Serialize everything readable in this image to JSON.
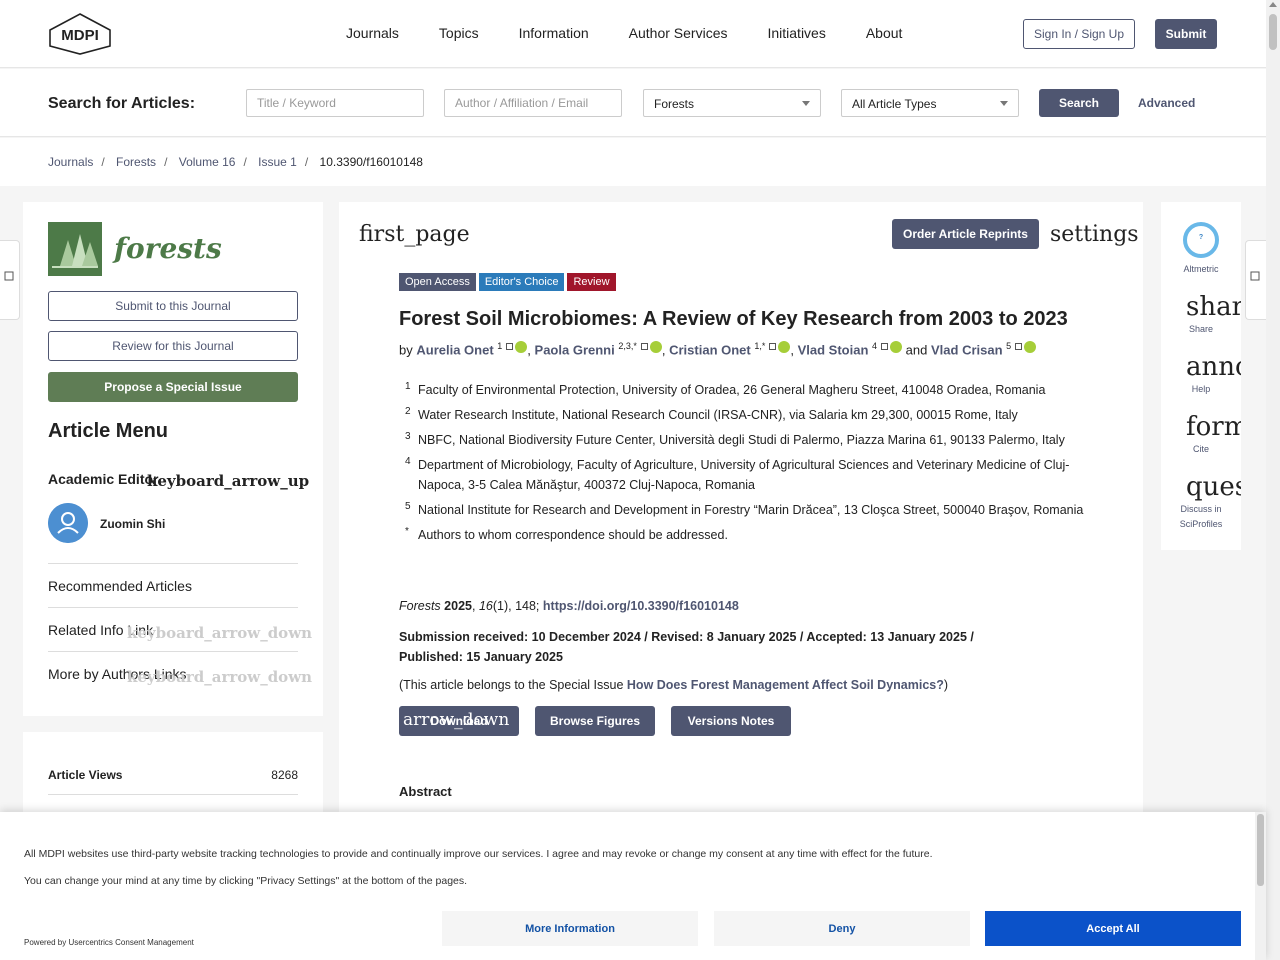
{
  "header": {
    "logo_text": "MDPI",
    "nav": [
      "Journals",
      "Topics",
      "Information",
      "Author Services",
      "Initiatives",
      "About"
    ],
    "sign_in": "Sign In / Sign Up",
    "submit": "Submit"
  },
  "search": {
    "label": "Search for Articles:",
    "title_placeholder": "Title / Keyword",
    "author_placeholder": "Author / Affiliation / Email",
    "journal_value": "Forests",
    "type_value": "All Article Types",
    "search_button": "Search",
    "advanced": "Advanced"
  },
  "breadcrumb": [
    "Journals",
    "Forests",
    "Volume 16",
    "Issue 1",
    "10.3390/f16010148"
  ],
  "sidebar": {
    "journal_name": "forests",
    "submit_btn": "Submit to this Journal",
    "review_btn": "Review for this Journal",
    "propose_btn": "Propose a Special Issue",
    "menu_title": "Article Menu",
    "academic_editor": "Academic Editor",
    "icon_up": "keyboard_arrow_up",
    "icon_down": "keyboard_arrow_down",
    "editor_name": "Zuomin Shi",
    "items": [
      "Recommended Articles",
      "Related Info Link",
      "More by Authors Links"
    ],
    "views_label": "Article Views",
    "views_value": "8268"
  },
  "article": {
    "first_page": "first_page",
    "reprints": "Order Article Reprints",
    "settings": "settings",
    "badges": [
      {
        "label": "Open Access",
        "color": "#4f5671"
      },
      {
        "label": "Editor's Choice",
        "color": "#2b7bba"
      },
      {
        "label": "Review",
        "color": "#a0162b"
      }
    ],
    "title": "Forest Soil Microbiomes: A Review of Key Research from 2003 to 2023",
    "by": "by",
    "authors": [
      {
        "name": "Aurelia Onet",
        "sup": "1"
      },
      {
        "name": "Paola Grenni",
        "sup": "2,3,*"
      },
      {
        "name": "Cristian Onet",
        "sup": "1,*"
      },
      {
        "name": "Vlad Stoian",
        "sup": "4"
      },
      {
        "name": "Vlad Crisan",
        "sup": "5"
      }
    ],
    "and": "and",
    "affiliations": [
      {
        "n": "1",
        "text": "Faculty of Environmental Protection, University of Oradea, 26 General Magheru Street, 410048 Oradea, Romania"
      },
      {
        "n": "2",
        "text": "Water Research Institute, National Research Council (IRSA-CNR), via Salaria km 29,300, 00015 Rome, Italy"
      },
      {
        "n": "3",
        "text": "NBFC, National Biodiversity Future Center, Università degli Studi di Palermo, Piazza Marina 61, 90133 Palermo, Italy"
      },
      {
        "n": "4",
        "text": "Department of Microbiology, Faculty of Agriculture, University of Agricultural Sciences and Veterinary Medicine of Cluj-Napoca, 3-5 Calea Mănăştur, 400372 Cluj-Napoca, Romania"
      },
      {
        "n": "5",
        "text": "National Institute for Research and Development in Forestry “Marin Drăcea”, 13 Cloşca Street, 500040 Braşov, Romania"
      },
      {
        "n": "*",
        "text": "Authors to whom correspondence should be addressed."
      }
    ],
    "citation_journal": "Forests",
    "citation_year": "2025",
    "citation_volume": "16",
    "citation_rest": "(1), 148;",
    "doi": "https://doi.org/10.3390/f16010148",
    "dates": "Submission received: 10 December 2024 / Revised: 8 January 2025 / Accepted: 13 January 2025 / Published: 15 January 2025",
    "special_prefix": "(This article belongs to the Special Issue",
    "special_link": "How Does Forest Management Affect Soil Dynamics?",
    "special_suffix": ")",
    "download": "Download",
    "download_icon": "arrow_down",
    "download_icon_text": "arrow_down",
    "browse_figures": "Browse Figures",
    "versions_notes": "Versions Notes",
    "abstract": "Abstract"
  },
  "rightbar": {
    "altmetric_value": "?",
    "altmetric": "Altmetric",
    "share_glyph": "share",
    "share": "Share",
    "help_glyph": "annou",
    "help": "Help",
    "cite_glyph": "forma",
    "cite": "Cite",
    "discuss_glyph": "quest",
    "discuss_line1": "Discuss in",
    "discuss_line2": "SciProfiles"
  },
  "consent": {
    "line1": "All MDPI websites use third-party website tracking technologies to provide and continually improve our services. I agree and may revoke or change my consent at any time with effect for the future.",
    "line2": "You can change your mind at any time by clicking \"Privacy Settings\" at the bottom of the pages.",
    "powered": "Powered by Usercentrics Consent Management",
    "more_info": "More Information",
    "deny": "Deny",
    "accept": "Accept All"
  }
}
